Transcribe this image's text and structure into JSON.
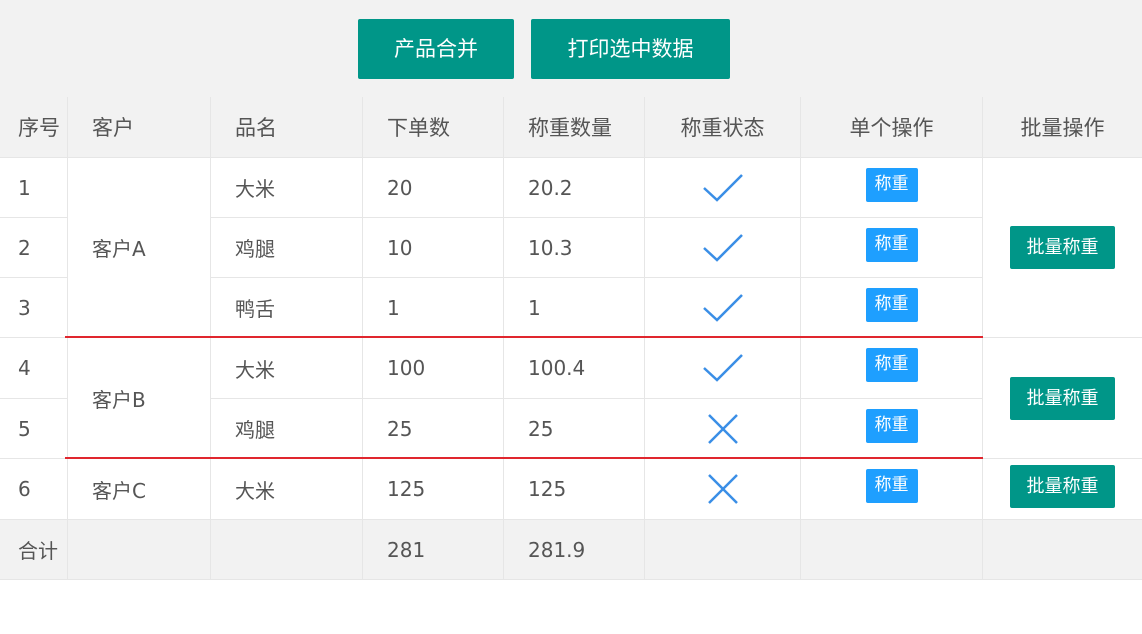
{
  "toolbar": {
    "merge_label": "产品合并",
    "print_label": "打印选中数据"
  },
  "headers": [
    "序号",
    "客户",
    "品名",
    "下单数",
    "称重数量",
    "称重状态",
    "单个操作",
    "批量操作"
  ],
  "rows": [
    {
      "no": "1",
      "product": "大米",
      "order": "20",
      "weight": "20.2",
      "status": "check",
      "action": "称重"
    },
    {
      "no": "2",
      "product": "鸡腿",
      "order": "10",
      "weight": "10.3",
      "status": "check",
      "action": "称重"
    },
    {
      "no": "3",
      "product": "鸭舌",
      "order": "1",
      "weight": "1",
      "status": "check",
      "action": "称重"
    },
    {
      "no": "4",
      "product": "大米",
      "order": "100",
      "weight": "100.4",
      "status": "check",
      "action": "称重"
    },
    {
      "no": "5",
      "product": "鸡腿",
      "order": "25",
      "weight": "25",
      "status": "cross",
      "action": "称重"
    },
    {
      "no": "6",
      "product": "大米",
      "order": "125",
      "weight": "125",
      "status": "cross",
      "action": "称重"
    }
  ],
  "groups": [
    {
      "customer": "客户A",
      "batch_label": "批量称重"
    },
    {
      "customer": "客户B",
      "batch_label": "批量称重"
    },
    {
      "customer": "客户C",
      "batch_label": "批量称重"
    }
  ],
  "footer": {
    "label": "合计",
    "order_total": "281",
    "weight_total": "281.9"
  },
  "colors": {
    "primary": "#009688",
    "normal": "#1e9fff",
    "status_icon": "#3a8ee6",
    "separator": "#e0262e"
  }
}
